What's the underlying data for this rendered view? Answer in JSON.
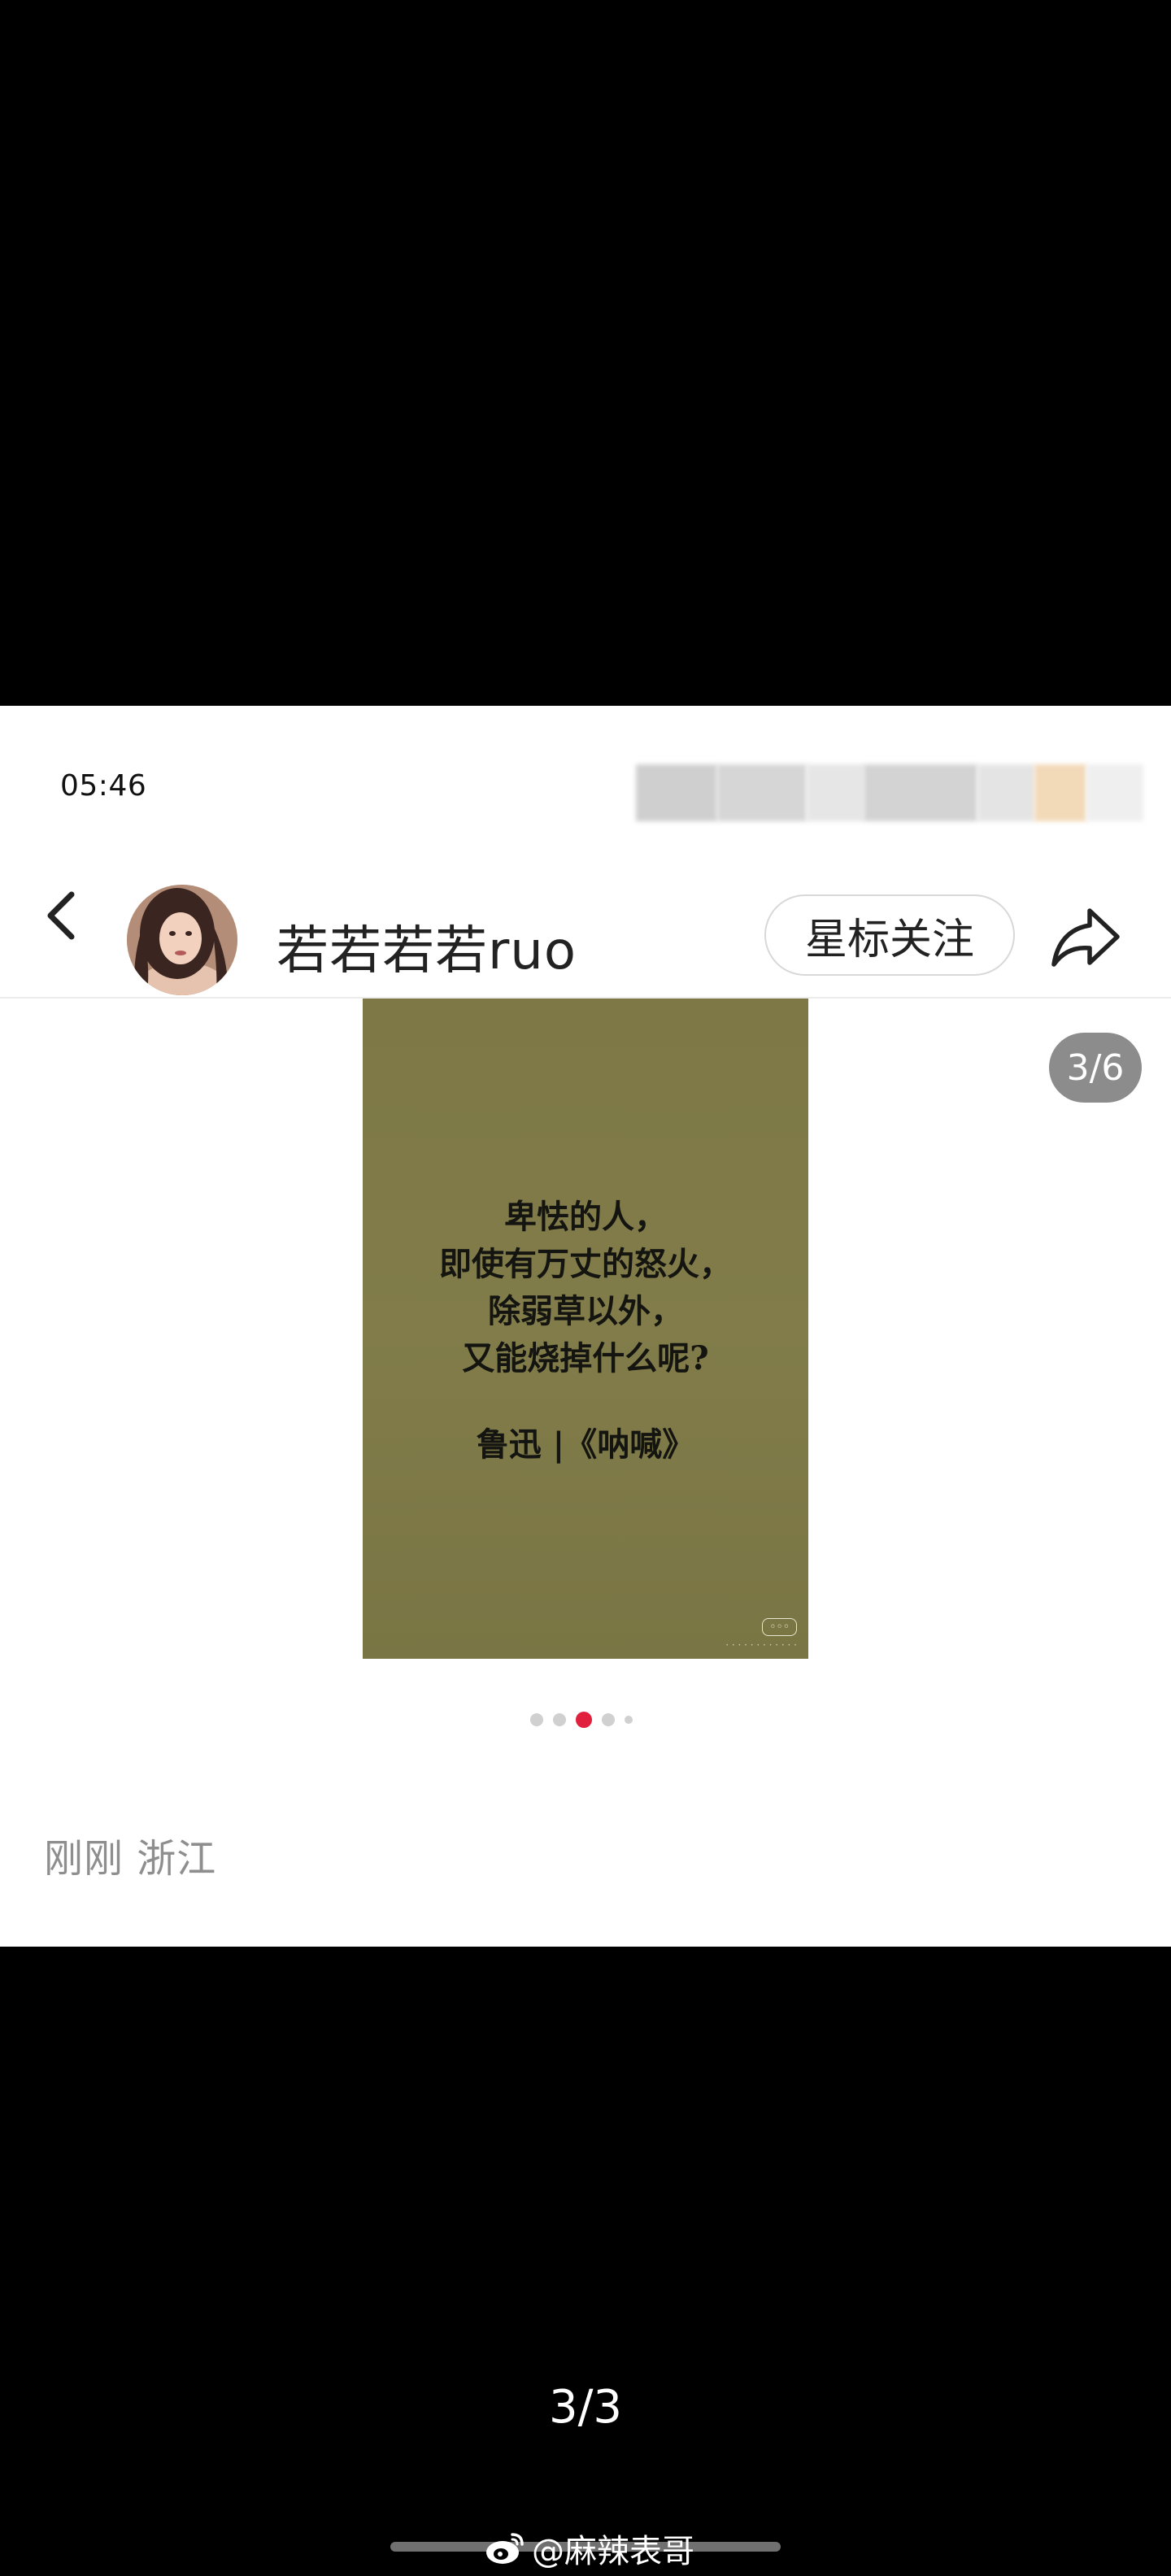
{
  "status_bar": {
    "time": "05:46"
  },
  "header": {
    "username": "若若若若ruo",
    "follow_label": "星标关注"
  },
  "viewer": {
    "page_indicator": "3/6",
    "poster": {
      "quote_lines": [
        "卑怯的人，",
        "即使有万丈的怒火，",
        "除弱草以外，",
        "又能烧掉什么呢?"
      ],
      "source": "鲁迅 |《呐喊》"
    },
    "dots_total": 5,
    "dots_active_index": 2
  },
  "post_meta": {
    "time_location": "刚刚 浙江"
  },
  "outer": {
    "image_counter": "3/3",
    "watermark": "@麻辣表哥"
  },
  "colors": {
    "accent_dot": "#e0203c",
    "poster_bg": "#7d7845",
    "badge_bg": "#8c8c8c"
  },
  "icons": {
    "back": "chevron-left-icon",
    "share": "share-arrow-icon",
    "weibo": "weibo-logo-icon"
  }
}
